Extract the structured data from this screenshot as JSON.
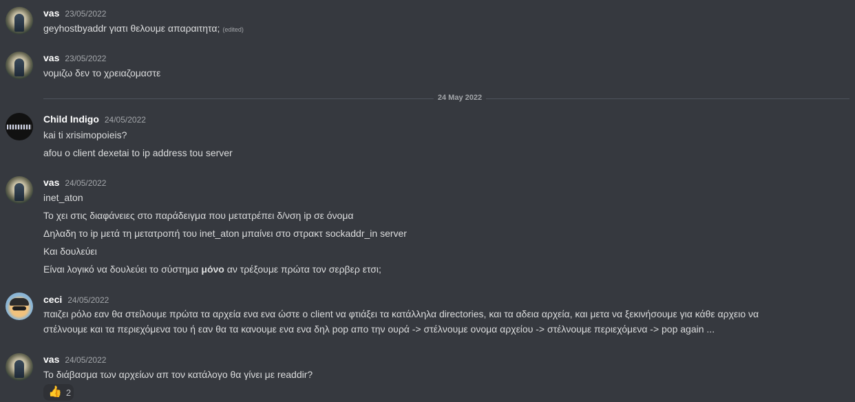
{
  "messages": [
    {
      "author": "vas",
      "timestamp": "23/05/2022",
      "lines": [
        "geyhostbyaddr γιατι θελουμε απαραιτητα;"
      ],
      "edited": "(edited)"
    },
    {
      "author": "vas",
      "timestamp": "23/05/2022",
      "lines": [
        "νομιζω δεν το χρειαζομαστε"
      ]
    },
    {
      "author": "Child Indigo",
      "timestamp": "24/05/2022",
      "lines": [
        "kai ti xrisimopoieis?",
        "afou o client dexetai to ip address tou server"
      ]
    },
    {
      "author": "vas",
      "timestamp": "24/05/2022",
      "lines": [
        "inet_aton",
        "Το χει στις διαφάνειες στο παράδειγμα που μετατρέπει δ/νση ip σε όνομα",
        "Δηλαδη το ip μετά τη μετατροπή του inet_aton μπαίνει στο στρακτ sockaddr_in server",
        "Και δουλεύει"
      ],
      "last_line": {
        "before": "Είναι λογικό να δουλεύει το σύστημα ",
        "bold": "μόνο",
        "after": " αν τρέξουμε πρώτα τον σερβερ ετσι;"
      }
    },
    {
      "author": "ceci",
      "timestamp": "24/05/2022",
      "lines": [
        "παιζει ρόλο εαν θα στείλουμε πρώτα τα αρχεία ενα ενα ώστε ο client να φτιάξει τα κατάλληλα directories, και τα αδεια αρχεία, και μετα να ξεκινήσουμε για κάθε αρχειο να",
        "στέλνουμε και τα περιεχόμενα του ή εαν θα τα κανουμε ενα ενα δηλ pop απο την ουρά -> στέλνουμε ονομα αρχείου -> στέλνουμε περιεχόμενα -> pop again ..."
      ]
    },
    {
      "author": "vas",
      "timestamp": "24/05/2022",
      "lines": [
        "Το διάβασμα των αρχείων απ τον κατάλογο θα γίνει με readdir?"
      ],
      "reaction": {
        "emoji": "👍",
        "icon": "thumbs-up-icon",
        "count": "2"
      }
    }
  ],
  "date_divider": "24 May 2022"
}
